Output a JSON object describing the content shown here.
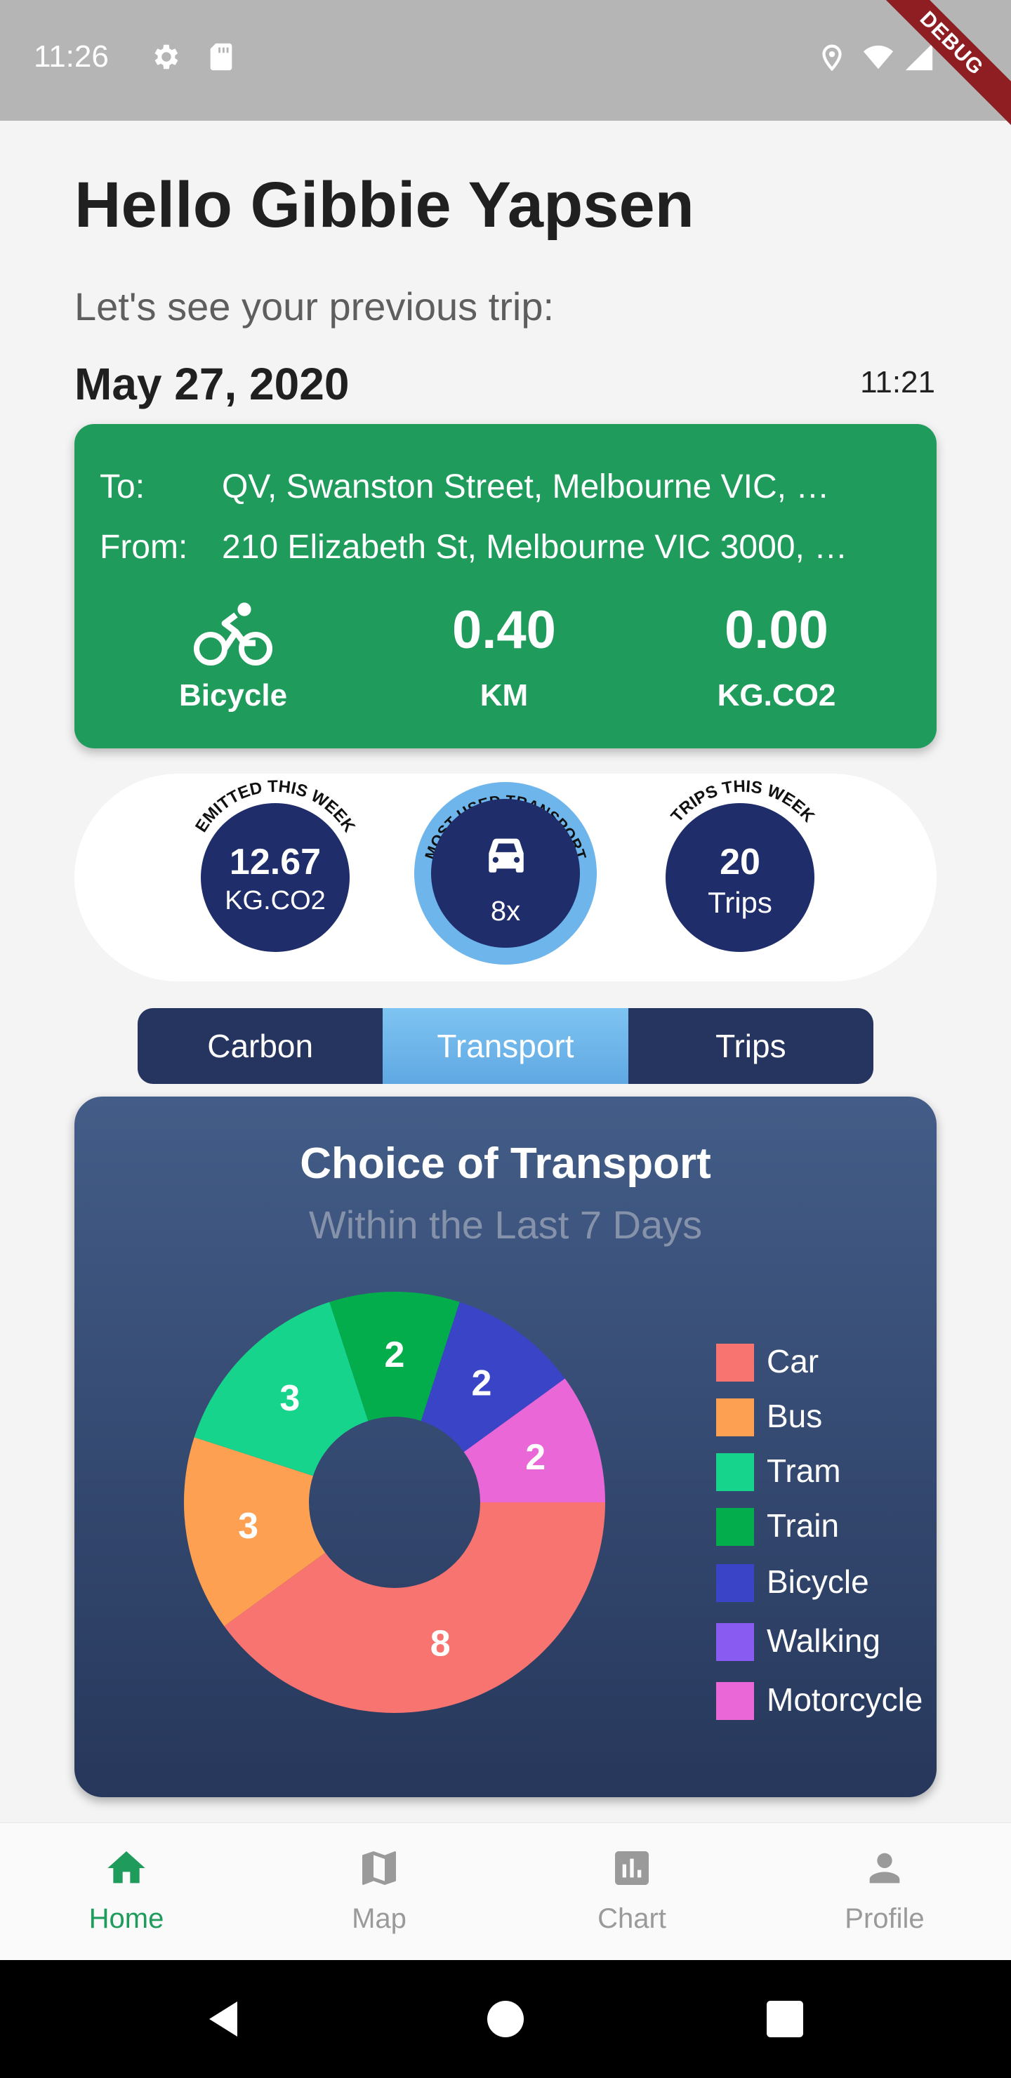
{
  "status_bar": {
    "time": "11:26",
    "debug_label": "DEBUG"
  },
  "greeting": "Hello Gibbie Yapsen",
  "subtitle": "Let's see your previous trip:",
  "trip": {
    "date": "May 27, 2020",
    "time": "11:21",
    "to_label": "To:",
    "to_value": "QV, Swanston Street, Melbourne VIC, …",
    "from_label": "From:",
    "from_value": "210 Elizabeth St, Melbourne VIC 3000, …",
    "mode": "Bicycle",
    "mode_icon": "bicycle-icon",
    "distance": "0.40",
    "distance_unit": "KM",
    "emissions": "0.00",
    "emissions_unit": "KG.CO2"
  },
  "summary": {
    "emitted": {
      "arc_label": "EMITTED THIS WEEK",
      "value": "12.67",
      "unit": "KG.CO2"
    },
    "most_used": {
      "arc_label": "MOST USED TRANSPORT",
      "icon": "car-icon",
      "count": "8x"
    },
    "trips": {
      "arc_label": "TRIPS THIS WEEK",
      "value": "20",
      "unit": "Trips"
    }
  },
  "tabs": [
    {
      "label": "Carbon",
      "active": false
    },
    {
      "label": "Transport",
      "active": true
    },
    {
      "label": "Trips",
      "active": false
    }
  ],
  "chart": {
    "title": "Choice of Transport",
    "subtitle": "Within the Last 7 Days"
  },
  "chart_data": {
    "type": "pie",
    "title": "Choice of Transport",
    "subtitle": "Within the Last 7 Days",
    "donut": true,
    "legend_position": "right",
    "categories": [
      "Car",
      "Bus",
      "Tram",
      "Train",
      "Bicycle",
      "Walking",
      "Motorcycle"
    ],
    "values": [
      8,
      3,
      3,
      2,
      2,
      0,
      2
    ],
    "colors": [
      "#f87470",
      "#fda052",
      "#17d48d",
      "#04ad4c",
      "#3a44c6",
      "#8a5bf0",
      "#ea67d8"
    ]
  },
  "bottom_nav": [
    {
      "label": "Home",
      "icon": "home-icon",
      "active": true
    },
    {
      "label": "Map",
      "icon": "map-icon",
      "active": false
    },
    {
      "label": "Chart",
      "icon": "chart-icon",
      "active": false
    },
    {
      "label": "Profile",
      "icon": "profile-icon",
      "active": false
    }
  ],
  "colors": {
    "green": "#1f9c5c",
    "navy": "#1f2d6b",
    "accent_blue": "#6db5ea"
  }
}
